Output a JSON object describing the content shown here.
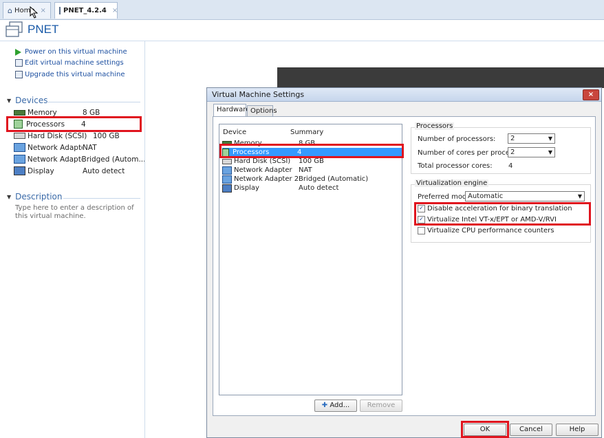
{
  "tabs": [
    {
      "label": "Home",
      "close": "×"
    },
    {
      "label": "PNET_4.2.4",
      "close": "×"
    }
  ],
  "header": {
    "title": "PNET"
  },
  "actions": [
    {
      "label": "Power on this virtual machine",
      "icon": "play-icon"
    },
    {
      "label": "Edit virtual machine settings",
      "icon": "edit-settings-icon"
    },
    {
      "label": "Upgrade this virtual machine",
      "icon": "upgrade-icon"
    }
  ],
  "devices": {
    "heading": "Devices",
    "items": [
      {
        "name": "Memory",
        "value": "8 GB",
        "icon": "memory-icon"
      },
      {
        "name": "Processors",
        "value": "4",
        "icon": "processor-icon"
      },
      {
        "name": "Hard Disk (SCSI)",
        "value": "100 GB",
        "icon": "disk-icon"
      },
      {
        "name": "Network Adapter",
        "value": "NAT",
        "icon": "network-icon"
      },
      {
        "name": "Network Adapte...",
        "value": "Bridged (Autom...",
        "icon": "network-icon"
      },
      {
        "name": "Display",
        "value": "Auto detect",
        "icon": "display-icon"
      }
    ]
  },
  "description": {
    "heading": "Description",
    "placeholder": "Type here to enter a description of this virtual machine."
  },
  "dialog": {
    "title": "Virtual Machine Settings",
    "close": "×",
    "tabs": [
      "Hardware",
      "Options"
    ],
    "list_headers": {
      "device": "Device",
      "summary": "Summary"
    },
    "list": [
      {
        "device": "Memory",
        "summary": "8 GB",
        "icon": "memory-icon"
      },
      {
        "device": "Processors",
        "summary": "4",
        "icon": "processor-icon"
      },
      {
        "device": "Hard Disk (SCSI)",
        "summary": "100 GB",
        "icon": "disk-icon"
      },
      {
        "device": "Network Adapter",
        "summary": "NAT",
        "icon": "network-icon"
      },
      {
        "device": "Network Adapter 2",
        "summary": "Bridged (Automatic)",
        "icon": "network-icon"
      },
      {
        "device": "Display",
        "summary": "Auto detect",
        "icon": "display-icon"
      }
    ],
    "add_button": "Add...",
    "remove_button": "Remove",
    "processors_group": {
      "title": "Processors",
      "num_processors_label": "Number of processors:",
      "num_processors_value": "2",
      "cores_label": "Number of cores per processor:",
      "cores_value": "2",
      "total_label": "Total processor cores:",
      "total_value": "4"
    },
    "virt_group": {
      "title": "Virtualization engine",
      "mode_label": "Preferred mode:",
      "mode_value": "Automatic",
      "options": [
        {
          "label": "Disable acceleration for binary translation",
          "checked": true
        },
        {
          "label": "Virtualize Intel VT-x/EPT or AMD-V/RVI",
          "checked": true
        },
        {
          "label": "Virtualize CPU performance counters",
          "checked": false
        }
      ]
    },
    "ok_button": "OK",
    "cancel_button": "Cancel",
    "help_button": "Help"
  },
  "colors": {
    "highlight": "#e0141e",
    "selection": "#3399ff",
    "link": "#1c4fa0"
  }
}
